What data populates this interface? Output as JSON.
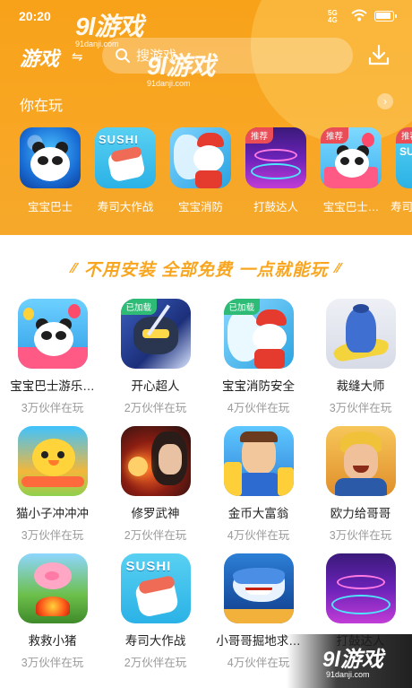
{
  "status": {
    "time": "20:20",
    "signal": "5G",
    "signal_sub": "4G"
  },
  "watermark": {
    "brand": "9l游戏",
    "domain": "91danji.com"
  },
  "nav": {
    "title": "游戏",
    "search_placeholder": "搜游戏"
  },
  "playing": {
    "heading": "你在玩"
  },
  "recent": [
    {
      "label": "宝宝巴士"
    },
    {
      "label": "寿司大作战"
    },
    {
      "label": "宝宝消防"
    },
    {
      "label": "打鼓达人",
      "tag": "推荐"
    },
    {
      "label": "宝宝巴士…",
      "tag": "推荐"
    },
    {
      "label": "寿司",
      "tag": "推荐"
    }
  ],
  "banner": {
    "slogan": "不用安装  全部免费  一点就能玩"
  },
  "games": [
    {
      "name": "宝宝巴士游乐…",
      "players": "3万伙伴在玩"
    },
    {
      "name": "开心超人",
      "players": "2万伙伴在玩",
      "tag": "已加载"
    },
    {
      "name": "宝宝消防安全",
      "players": "4万伙伴在玩",
      "tag": "已加载"
    },
    {
      "name": "裁缝大师",
      "players": "3万伙伴在玩"
    },
    {
      "name": "猫小子冲冲冲",
      "players": "3万伙伴在玩"
    },
    {
      "name": "修罗武神",
      "players": "2万伙伴在玩"
    },
    {
      "name": "金币大富翁",
      "players": "4万伙伴在玩"
    },
    {
      "name": "欧力给哥哥",
      "players": "3万伙伴在玩"
    },
    {
      "name": "救救小猪",
      "players": "3万伙伴在玩"
    },
    {
      "name": "寿司大作战",
      "players": "2万伙伴在玩"
    },
    {
      "name": "小哥哥掘地求…",
      "players": "4万伙伴在玩"
    },
    {
      "name": "打鼓达人",
      "players": ""
    }
  ],
  "icons": {
    "search": "search-icon",
    "download": "download-icon",
    "swap": "swap-icon",
    "more": "chevron-right-icon"
  },
  "colors": {
    "accent": "#f8a620",
    "header": "#f8a21a",
    "loaded_tag": "#2dbb76",
    "recommend_tag": "#ea4d55"
  }
}
